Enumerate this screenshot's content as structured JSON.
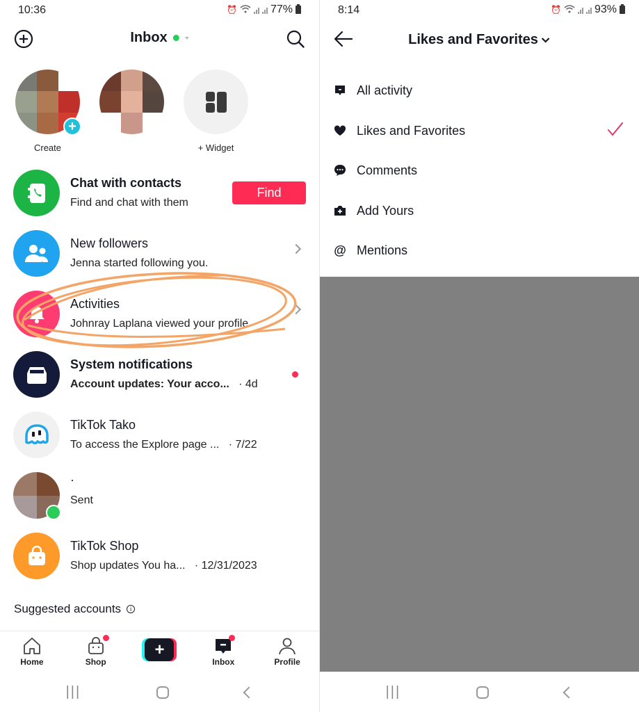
{
  "left_screen": {
    "status_bar": {
      "time": "10:36",
      "battery": "77%"
    },
    "header": {
      "title": "Inbox",
      "online_status_color": "#2bcd5a",
      "add_icon": "plus-circle-icon",
      "search_icon": "search-icon"
    },
    "stories": [
      {
        "label": "Create",
        "type": "own-avatar",
        "badge": "+"
      },
      {
        "label": "",
        "type": "friend-avatar"
      },
      {
        "label": "+ Widget",
        "type": "widget"
      }
    ],
    "messages": [
      {
        "title": "Chat with contacts",
        "subtitle": "Find and chat with them",
        "icon": "contacts-book-icon",
        "icon_color": "#1db446",
        "action": "Find",
        "title_bold": true
      },
      {
        "title": "New followers",
        "subtitle": "Jenna started following you.",
        "icon": "people-icon",
        "icon_color": "#20a4ef",
        "chevron": true
      },
      {
        "title": "Activities",
        "subtitle": "Johnray Laplana viewed your profile.",
        "icon": "bell-icon",
        "icon_color": "#fe3c72",
        "chevron": true,
        "highlighted": true
      },
      {
        "title": "System notifications",
        "subtitle": "Account updates: Your acco...",
        "time": "· 4d",
        "icon": "inbox-tray-icon",
        "icon_color": "#131a3a",
        "unread": true,
        "title_bold": true
      },
      {
        "title": "TikTok Tako",
        "subtitle": "To access the Explore page ...",
        "time": "· 7/22",
        "icon": "tako-ghost-icon",
        "icon_color": "#f1f1f2"
      },
      {
        "title": "·",
        "subtitle": "Sent",
        "icon": "user-avatar",
        "online": true
      },
      {
        "title": "TikTok Shop",
        "subtitle": "Shop updates You ha...",
        "time": "· 12/31/2023",
        "icon": "shopping-bag-icon",
        "icon_color": "#fd9a2a"
      }
    ],
    "suggested_accounts": {
      "label": "Suggested accounts",
      "info_icon": "info-icon"
    },
    "bottom_nav": [
      {
        "label": "Home",
        "icon": "home-icon"
      },
      {
        "label": "Shop",
        "icon": "shop-bag-icon",
        "badge": true
      },
      {
        "label": "",
        "icon": "create-plus-icon"
      },
      {
        "label": "Inbox",
        "icon": "inbox-message-icon",
        "badge": true,
        "active": true
      },
      {
        "label": "Profile",
        "icon": "profile-icon"
      }
    ]
  },
  "right_screen": {
    "status_bar": {
      "time": "8:14",
      "battery": "93%"
    },
    "header": {
      "title": "Likes and Favorites"
    },
    "filter_options": [
      {
        "label": "All activity",
        "icon": "message-square-icon",
        "selected": false
      },
      {
        "label": "Likes and Favorites",
        "icon": "heart-icon",
        "selected": true
      },
      {
        "label": "Comments",
        "icon": "comment-bubble-icon",
        "selected": false
      },
      {
        "label": "Add Yours",
        "icon": "add-camera-icon",
        "selected": false
      },
      {
        "label": "Mentions",
        "icon": "at-sign-icon",
        "selected": false
      }
    ],
    "check_color": "#e0366a"
  },
  "colors": {
    "brand_red": "#fe2c55",
    "brand_cyan": "#25f4ee",
    "overlay_gray": "#808080",
    "annotation_orange": "#f3a467"
  }
}
